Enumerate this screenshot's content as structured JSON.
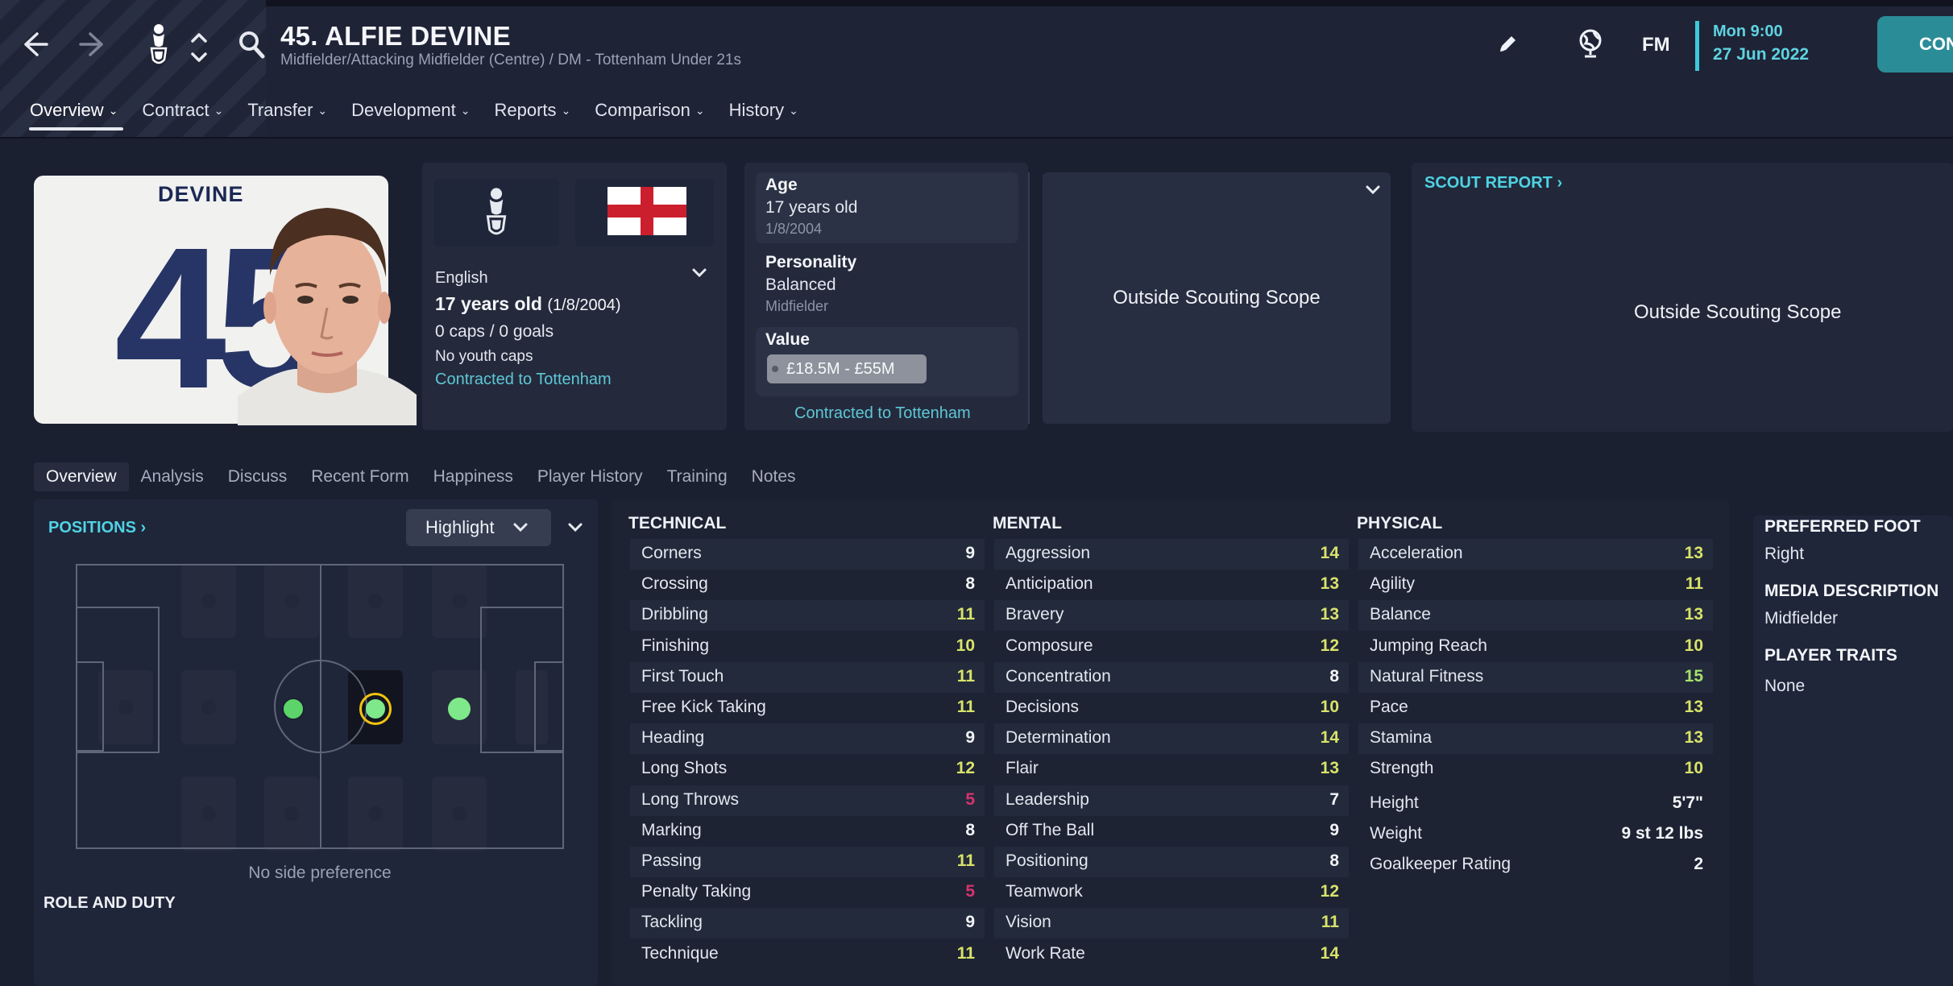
{
  "header": {
    "title": "45. ALFIE DEVINE",
    "subtitle": "Midfielder/Attacking Midfielder (Centre) / DM - Tottenham Under 21s",
    "date_time": "Mon 9:00",
    "date_day": "27 Jun 2022",
    "fm_label": "FM",
    "continue_label": "CON",
    "icons": {
      "back": "arrow-left-icon",
      "forward": "arrow-right-icon",
      "club": "club-crest-icon",
      "updown": "up-down-chevron-icon",
      "search": "search-icon",
      "edit": "pencil-icon",
      "globe": "globe-icon"
    }
  },
  "top_tabs": [
    {
      "label": "Overview"
    },
    {
      "label": "Contract"
    },
    {
      "label": "Transfer"
    },
    {
      "label": "Development"
    },
    {
      "label": "Reports"
    },
    {
      "label": "Comparison"
    },
    {
      "label": "History"
    }
  ],
  "profile": {
    "shirt_name": "DEVINE",
    "shirt_number": "45",
    "nationality": "English",
    "age_text": "17 years old",
    "dob_paren": "(1/8/2004)",
    "caps": "0 caps / 0 goals",
    "youth_caps": "No youth caps",
    "contract": "Contracted to Tottenham"
  },
  "info": {
    "age_title": "Age",
    "age_value": "17 years old",
    "age_dob": "1/8/2004",
    "personality_title": "Personality",
    "personality_value": "Balanced",
    "personality_sub": "Midfielder",
    "value_title": "Value",
    "value_range": "£18.5M - £55M",
    "contract": "Contracted to Tottenham"
  },
  "scouting": {
    "scope_text_1": "Outside Scouting Scope",
    "scout_report_label": "SCOUT REPORT ›",
    "scope_text_2": "Outside Scouting Scope"
  },
  "sub_tabs": [
    {
      "label": "Overview"
    },
    {
      "label": "Analysis"
    },
    {
      "label": "Discuss"
    },
    {
      "label": "Recent Form"
    },
    {
      "label": "Happiness"
    },
    {
      "label": "Player History"
    },
    {
      "label": "Training"
    },
    {
      "label": "Notes"
    }
  ],
  "positions": {
    "title": "POSITIONS ›",
    "highlight_label": "Highlight",
    "side_preference": "No side preference",
    "role_duty_title": "ROLE AND DUTY"
  },
  "attributes": {
    "technical_title": "TECHNICAL",
    "mental_title": "MENTAL",
    "physical_title": "PHYSICAL",
    "technical": [
      {
        "name": "Corners",
        "value": "9"
      },
      {
        "name": "Crossing",
        "value": "8"
      },
      {
        "name": "Dribbling",
        "value": "11"
      },
      {
        "name": "Finishing",
        "value": "10"
      },
      {
        "name": "First Touch",
        "value": "11"
      },
      {
        "name": "Free Kick Taking",
        "value": "11"
      },
      {
        "name": "Heading",
        "value": "9"
      },
      {
        "name": "Long Shots",
        "value": "12"
      },
      {
        "name": "Long Throws",
        "value": "5"
      },
      {
        "name": "Marking",
        "value": "8"
      },
      {
        "name": "Passing",
        "value": "11"
      },
      {
        "name": "Penalty Taking",
        "value": "5"
      },
      {
        "name": "Tackling",
        "value": "9"
      },
      {
        "name": "Technique",
        "value": "11"
      }
    ],
    "mental": [
      {
        "name": "Aggression",
        "value": "14"
      },
      {
        "name": "Anticipation",
        "value": "13"
      },
      {
        "name": "Bravery",
        "value": "13"
      },
      {
        "name": "Composure",
        "value": "12"
      },
      {
        "name": "Concentration",
        "value": "8"
      },
      {
        "name": "Decisions",
        "value": "10"
      },
      {
        "name": "Determination",
        "value": "14"
      },
      {
        "name": "Flair",
        "value": "13"
      },
      {
        "name": "Leadership",
        "value": "7"
      },
      {
        "name": "Off The Ball",
        "value": "9"
      },
      {
        "name": "Positioning",
        "value": "8"
      },
      {
        "name": "Teamwork",
        "value": "12"
      },
      {
        "name": "Vision",
        "value": "11"
      },
      {
        "name": "Work Rate",
        "value": "14"
      }
    ],
    "physical": [
      {
        "name": "Acceleration",
        "value": "13"
      },
      {
        "name": "Agility",
        "value": "11"
      },
      {
        "name": "Balance",
        "value": "13"
      },
      {
        "name": "Jumping Reach",
        "value": "10"
      },
      {
        "name": "Natural Fitness",
        "value": "15"
      },
      {
        "name": "Pace",
        "value": "13"
      },
      {
        "name": "Stamina",
        "value": "13"
      },
      {
        "name": "Strength",
        "value": "10"
      }
    ],
    "physical_extra": [
      {
        "name": "Height",
        "value": "5'7\""
      },
      {
        "name": "Weight",
        "value": "9 st 12 lbs"
      },
      {
        "name": "Goalkeeper Rating",
        "value": "2"
      }
    ]
  },
  "side": {
    "foot_title": "PREFERRED FOOT",
    "foot_value": "Right",
    "media_title": "MEDIA DESCRIPTION",
    "media_value": "Midfielder",
    "traits_title": "PLAYER TRAITS",
    "traits_value": "None"
  },
  "colors": {
    "accent": "#4fd3e4",
    "value_low": "#d6336c",
    "value_mid": "#f2f4f7",
    "value_good": "#d9e36a",
    "value_high": "#a6e06e"
  }
}
